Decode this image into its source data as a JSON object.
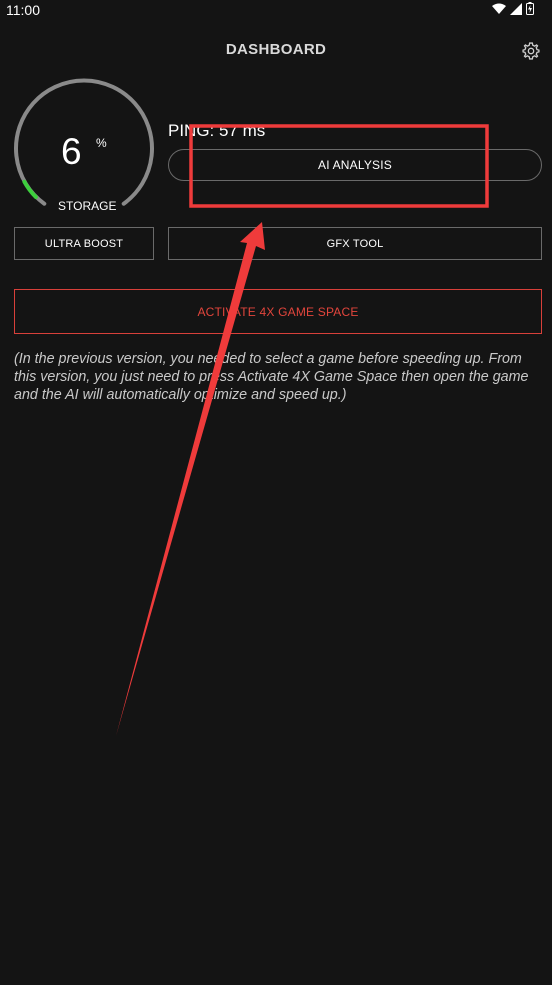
{
  "status_bar": {
    "time": "11:00",
    "icons": [
      "wifi-icon",
      "signal-icon",
      "battery-icon"
    ]
  },
  "header": {
    "title": "DASHBOARD",
    "settings_icon": "gear-icon"
  },
  "storage_gauge": {
    "value": "6",
    "unit": "%",
    "label": "STORAGE",
    "level_percent": 6,
    "track_color": "#8a8a8a",
    "fill_color": "#3ecf3e"
  },
  "ping": {
    "text": "PING: 57 ms"
  },
  "buttons": {
    "ai_analysis": "AI ANALYSIS",
    "ultra_boost": "ULTRA BOOST",
    "gfx_tool": "GFX TOOL",
    "activate": "ACTIVATE 4X GAME SPACE"
  },
  "notice": "(In the previous version, you needed to select a game before speeding up. From this version, you just need to press Activate 4X Game Space then open the game and the AI will automatically optimize and speed up.)",
  "colors": {
    "background": "#141414",
    "accent_red": "#e2453c",
    "annotation_red": "#ef3b3b"
  }
}
